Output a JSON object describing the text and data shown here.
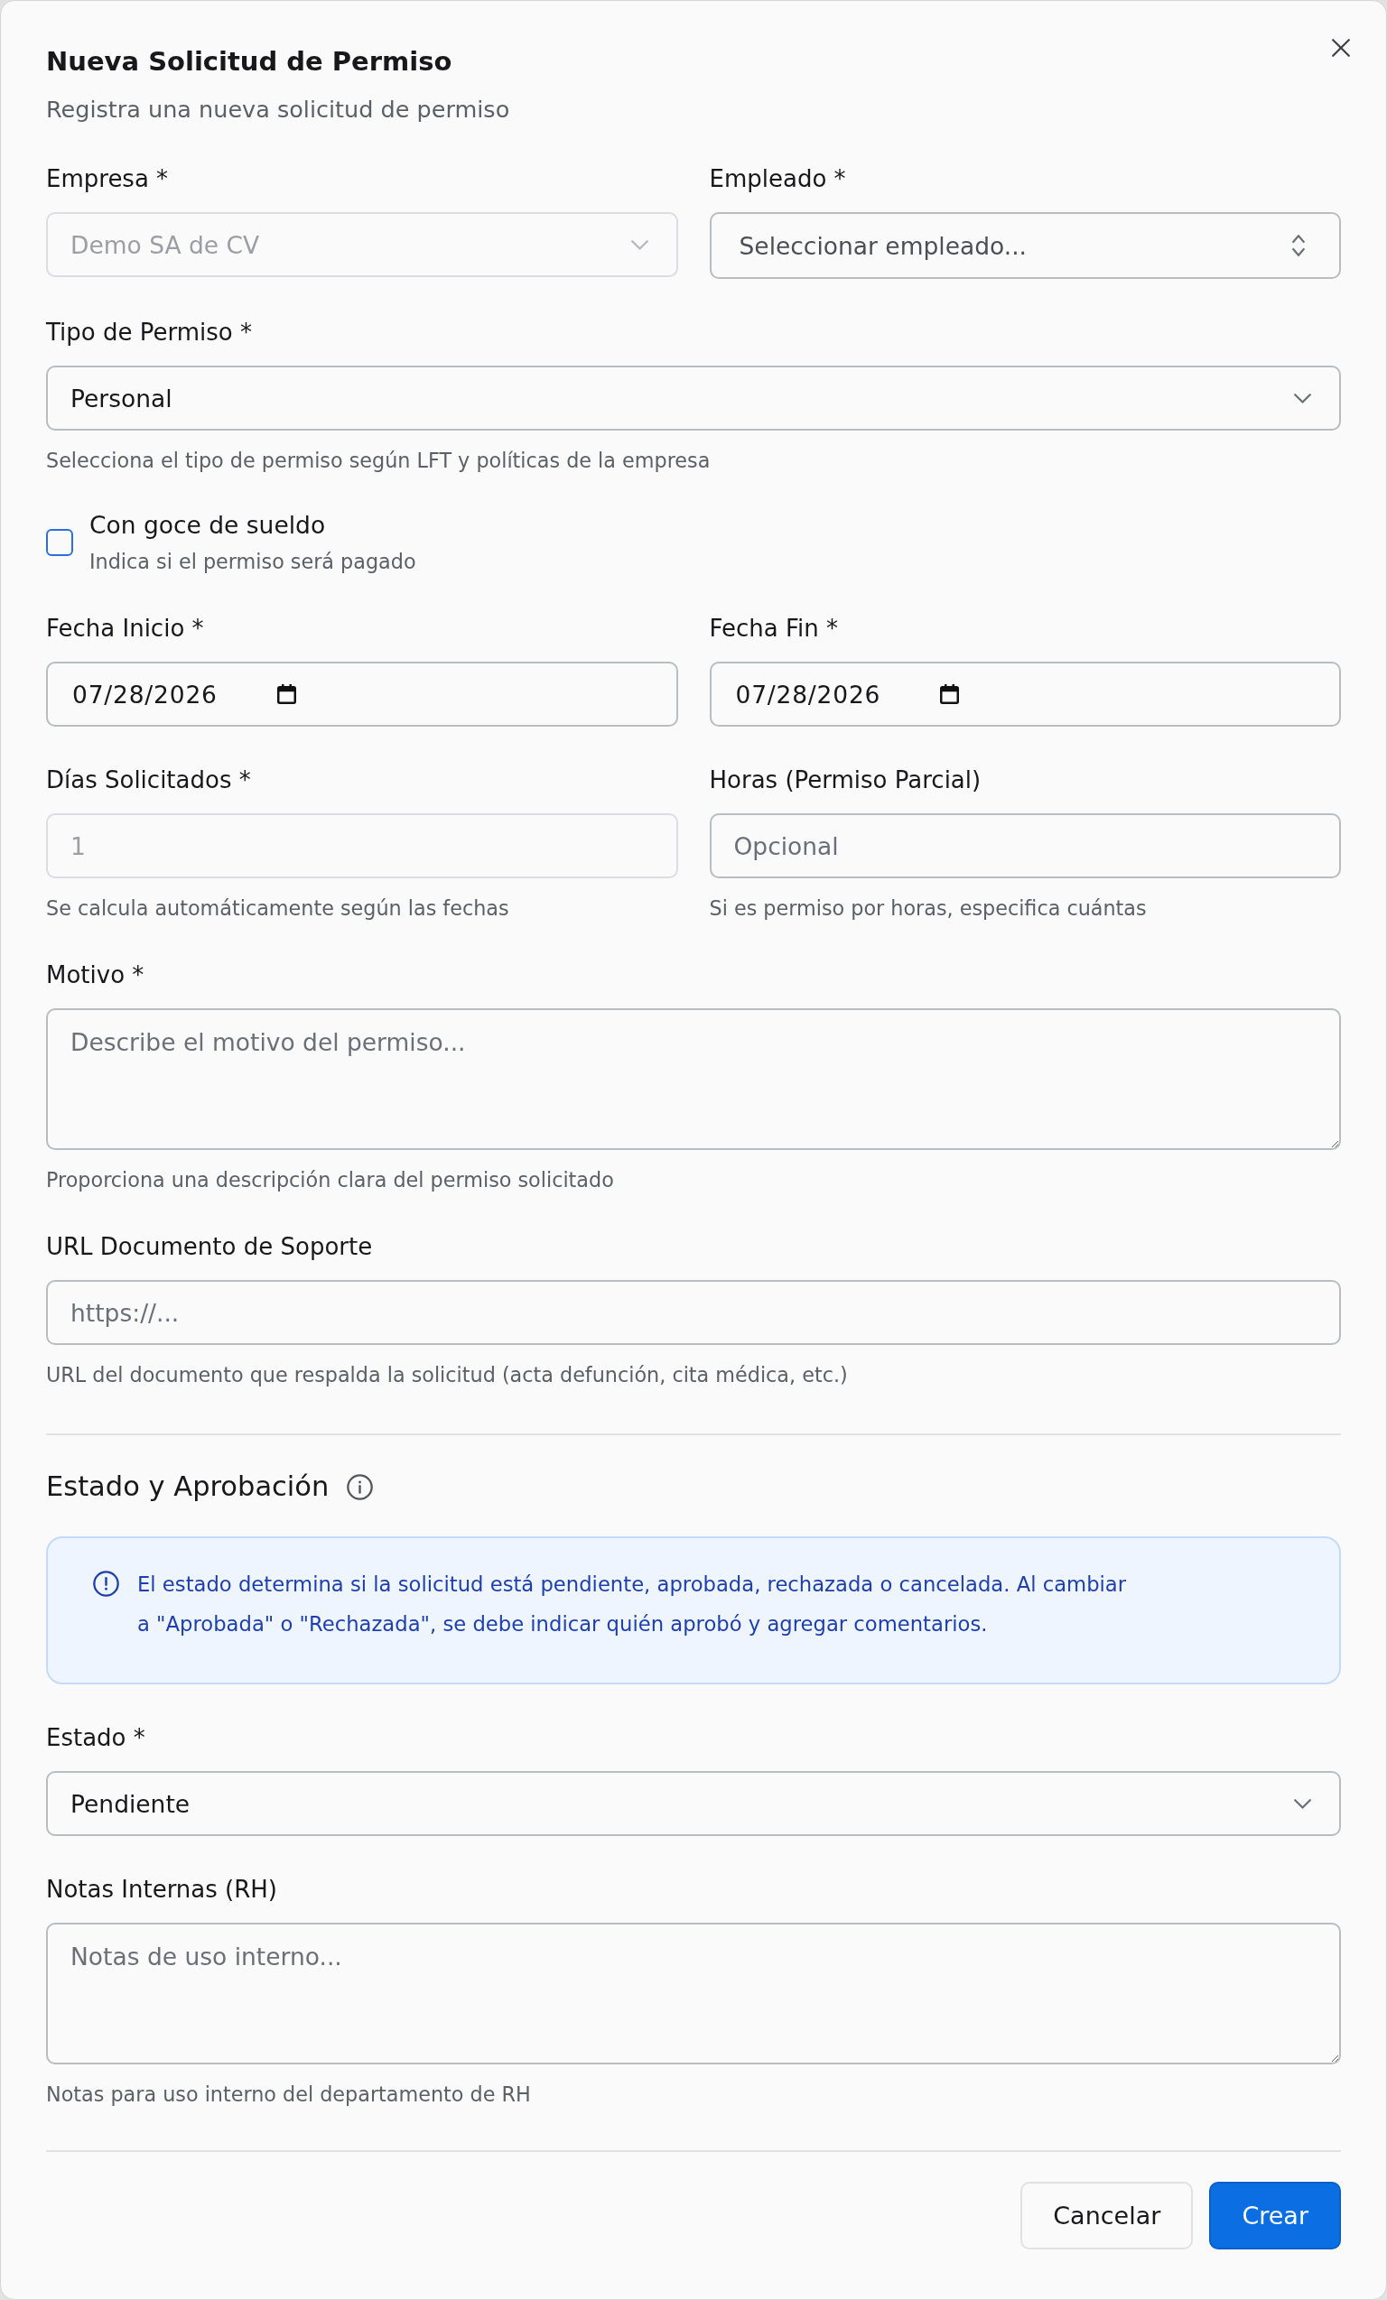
{
  "dialog": {
    "title": "Nueva Solicitud de Permiso",
    "subtitle": "Registra una nueva solicitud de permiso"
  },
  "form": [
    {
      "kind": "row",
      "fields": [
        {
          "kind": "select",
          "label": "Empresa *",
          "value": "Demo SA de CV",
          "disabled": true
        },
        {
          "kind": "combobox",
          "label": "Empleado *",
          "placeholder": "Seleccionar empleado...",
          "disabled": false
        }
      ]
    },
    {
      "kind": "row",
      "fields": [
        {
          "kind": "select",
          "label": "Tipo de Permiso *",
          "value": "Personal",
          "disabled": false,
          "helper": "Selecciona el tipo de permiso según LFT y políticas de la empresa"
        }
      ]
    },
    {
      "kind": "checkbox",
      "label": "Con goce de sueldo",
      "description": "Indica si el permiso será pagado",
      "checked": false
    },
    {
      "kind": "row",
      "fields": [
        {
          "kind": "date",
          "label": "Fecha Inicio *",
          "value": "07/28/2026",
          "disabled": false
        },
        {
          "kind": "date",
          "label": "Fecha Fin *",
          "value": "07/28/2026",
          "disabled": false
        }
      ]
    },
    {
      "kind": "row",
      "fields": [
        {
          "kind": "input",
          "label": "Días Solicitados *",
          "value": "1",
          "disabled": true,
          "helper": "Se calcula automáticamente según las fechas"
        },
        {
          "kind": "input",
          "label": "Horas (Permiso Parcial)",
          "placeholder": "Opcional",
          "disabled": false,
          "helper": "Si es permiso por horas, especifica cuántas"
        }
      ]
    },
    {
      "kind": "row",
      "fields": [
        {
          "kind": "textarea",
          "label": "Motivo *",
          "placeholder": "Describe el motivo del permiso...",
          "disabled": false,
          "helper": "Proporciona una descripción clara del permiso solicitado"
        }
      ]
    },
    {
      "kind": "row",
      "fields": [
        {
          "kind": "input",
          "label": "URL Documento de Soporte",
          "placeholder": "https://...",
          "disabled": false,
          "helper": "URL del documento que respalda la solicitud (acta defunción, cita médica, etc.)"
        }
      ]
    },
    {
      "kind": "section",
      "title": "Estado y Aprobación"
    },
    {
      "kind": "alert",
      "text": "El estado determina si la solicitud está pendiente, aprobada, rechazada o cancelada. Al cambiar a \"Aprobada\" o \"Rechazada\", se debe indicar quién aprobó y agregar comentarios."
    },
    {
      "kind": "row",
      "fields": [
        {
          "kind": "select",
          "label": "Estado *",
          "value": "Pendiente",
          "disabled": false
        }
      ]
    },
    {
      "kind": "row",
      "fields": [
        {
          "kind": "textarea",
          "label": "Notas Internas (RH)",
          "placeholder": "Notas de uso interno...",
          "disabled": false,
          "helper": "Notas para uso interno del departamento de RH"
        }
      ]
    }
  ],
  "footer": {
    "buttons": [
      {
        "kind": "secondary",
        "label": "Cancelar"
      },
      {
        "kind": "primary",
        "label": "Crear"
      }
    ]
  }
}
